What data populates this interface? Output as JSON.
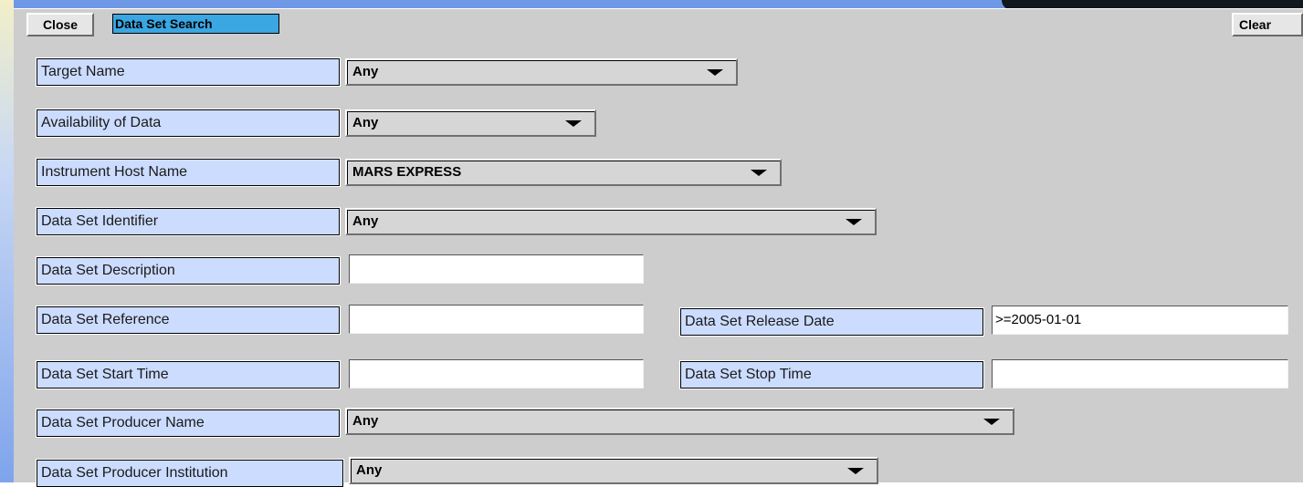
{
  "toolbar": {
    "close_label": "Close",
    "title": "Data Set Search",
    "clear_label": "Clear"
  },
  "fields": {
    "target_name": {
      "label": "Target Name",
      "value": "Any"
    },
    "availability": {
      "label": "Availability of Data",
      "value": "Any"
    },
    "instrument_host": {
      "label": "Instrument Host Name",
      "value": "MARS EXPRESS"
    },
    "data_set_identifier": {
      "label": "Data Set Identifier",
      "value": "Any"
    },
    "data_set_description": {
      "label": "Data Set Description",
      "value": ""
    },
    "data_set_reference": {
      "label": "Data Set Reference",
      "value": ""
    },
    "data_set_release_date": {
      "label": "Data Set Release Date",
      "value": ">=2005-01-01"
    },
    "data_set_start_time": {
      "label": "Data Set Start Time",
      "value": ""
    },
    "data_set_stop_time": {
      "label": "Data Set Stop Time",
      "value": ""
    },
    "producer_name": {
      "label": "Data Set Producer Name",
      "value": "Any"
    },
    "producer_institution": {
      "label": "Data Set Producer Institution",
      "value": "Any"
    }
  },
  "colors": {
    "panel": "#cdcdcd",
    "label_bg": "#ccdcff",
    "title_bg": "#3aa6e2",
    "frame_blue": "#6f98e6"
  },
  "icons": {
    "dropdown": "chevron-down-icon"
  }
}
